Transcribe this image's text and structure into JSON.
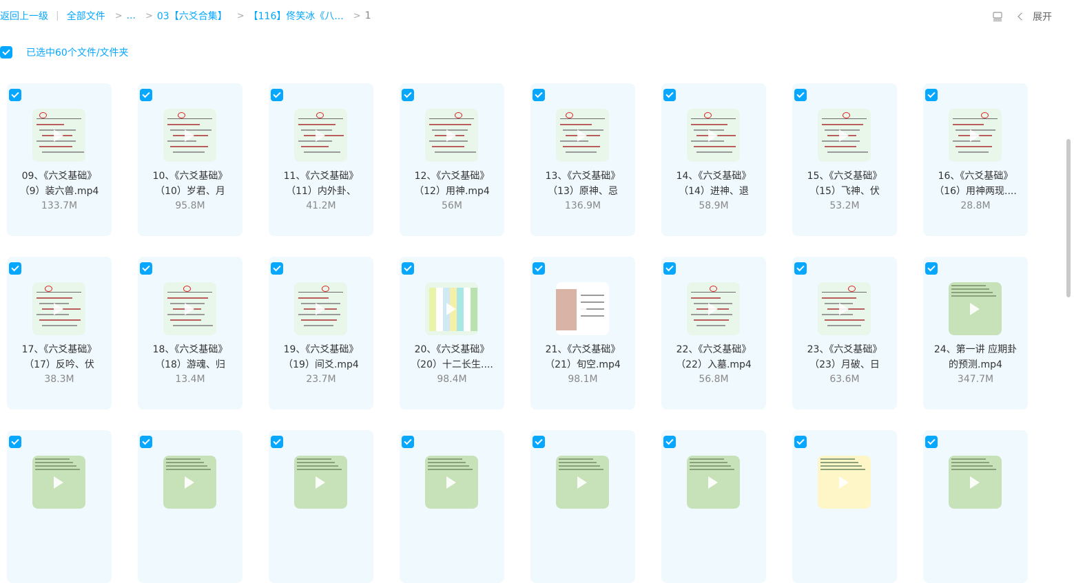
{
  "breadcrumb": {
    "back": "返回上一级",
    "items": [
      "全部文件",
      "...",
      "03【六爻合集】",
      "【116】佟笑冰《八...",
      "1"
    ]
  },
  "toolbar": {
    "expand": "展开"
  },
  "selection": {
    "label": "已选中60个文件/文件夹"
  },
  "colors": {
    "accent": "#06a7ff",
    "card_bg": "#f0f9fe"
  },
  "files": [
    {
      "line1": "09、《六爻基础》",
      "line2": "（9）装六兽.mp4",
      "size": "133.7M",
      "thumb": "doc"
    },
    {
      "line1": "10、《六爻基础》",
      "line2": "（10）岁君、月",
      "size": "95.8M",
      "thumb": "doc"
    },
    {
      "line1": "11、《六爻基础》",
      "line2": "（11）内外卦、",
      "size": "41.2M",
      "thumb": "doc"
    },
    {
      "line1": "12、《六爻基础》",
      "line2": "（12）用神.mp4",
      "size": "56M",
      "thumb": "doc"
    },
    {
      "line1": "13、《六爻基础》",
      "line2": "（13）原神、忌",
      "size": "136.9M",
      "thumb": "doc"
    },
    {
      "line1": "14、《六爻基础》",
      "line2": "（14）进神、退",
      "size": "58.9M",
      "thumb": "doc"
    },
    {
      "line1": "15、《六爻基础》",
      "line2": "（15）飞神、伏",
      "size": "53.2M",
      "thumb": "doc"
    },
    {
      "line1": "16、《六爻基础》",
      "line2": "（16）用神两现....",
      "size": "28.8M",
      "thumb": "doc"
    },
    {
      "line1": "17、《六爻基础》",
      "line2": "（17）反吟、伏",
      "size": "38.3M",
      "thumb": "doc"
    },
    {
      "line1": "18、《六爻基础》",
      "line2": "（18）游魂、归",
      "size": "13.4M",
      "thumb": "doc"
    },
    {
      "line1": "19、《六爻基础》",
      "line2": "（19）间爻.mp4",
      "size": "23.7M",
      "thumb": "doc"
    },
    {
      "line1": "20、《六爻基础》",
      "line2": "（20）十二长生....",
      "size": "98.4M",
      "thumb": "table"
    },
    {
      "line1": "21、《六爻基础》",
      "line2": "（21）旬空.mp4",
      "size": "98.1M",
      "thumb": "photo"
    },
    {
      "line1": "22、《六爻基础》",
      "line2": "（22）入墓.mp4",
      "size": "56.8M",
      "thumb": "doc"
    },
    {
      "line1": "23、《六爻基础》",
      "line2": "（23）月破、日",
      "size": "63.6M",
      "thumb": "doc"
    },
    {
      "line1": "24、第一讲 应期卦",
      "line2": "的预测.mp4",
      "size": "347.7M",
      "thumb": "green"
    },
    {
      "line1": "",
      "line2": "",
      "size": "",
      "thumb": "green"
    },
    {
      "line1": "",
      "line2": "",
      "size": "",
      "thumb": "green"
    },
    {
      "line1": "",
      "line2": "",
      "size": "",
      "thumb": "green"
    },
    {
      "line1": "",
      "line2": "",
      "size": "",
      "thumb": "green"
    },
    {
      "line1": "",
      "line2": "",
      "size": "",
      "thumb": "green"
    },
    {
      "line1": "",
      "line2": "",
      "size": "",
      "thumb": "green"
    },
    {
      "line1": "",
      "line2": "",
      "size": "",
      "thumb": "yellow"
    },
    {
      "line1": "",
      "line2": "",
      "size": "",
      "thumb": "green"
    }
  ]
}
